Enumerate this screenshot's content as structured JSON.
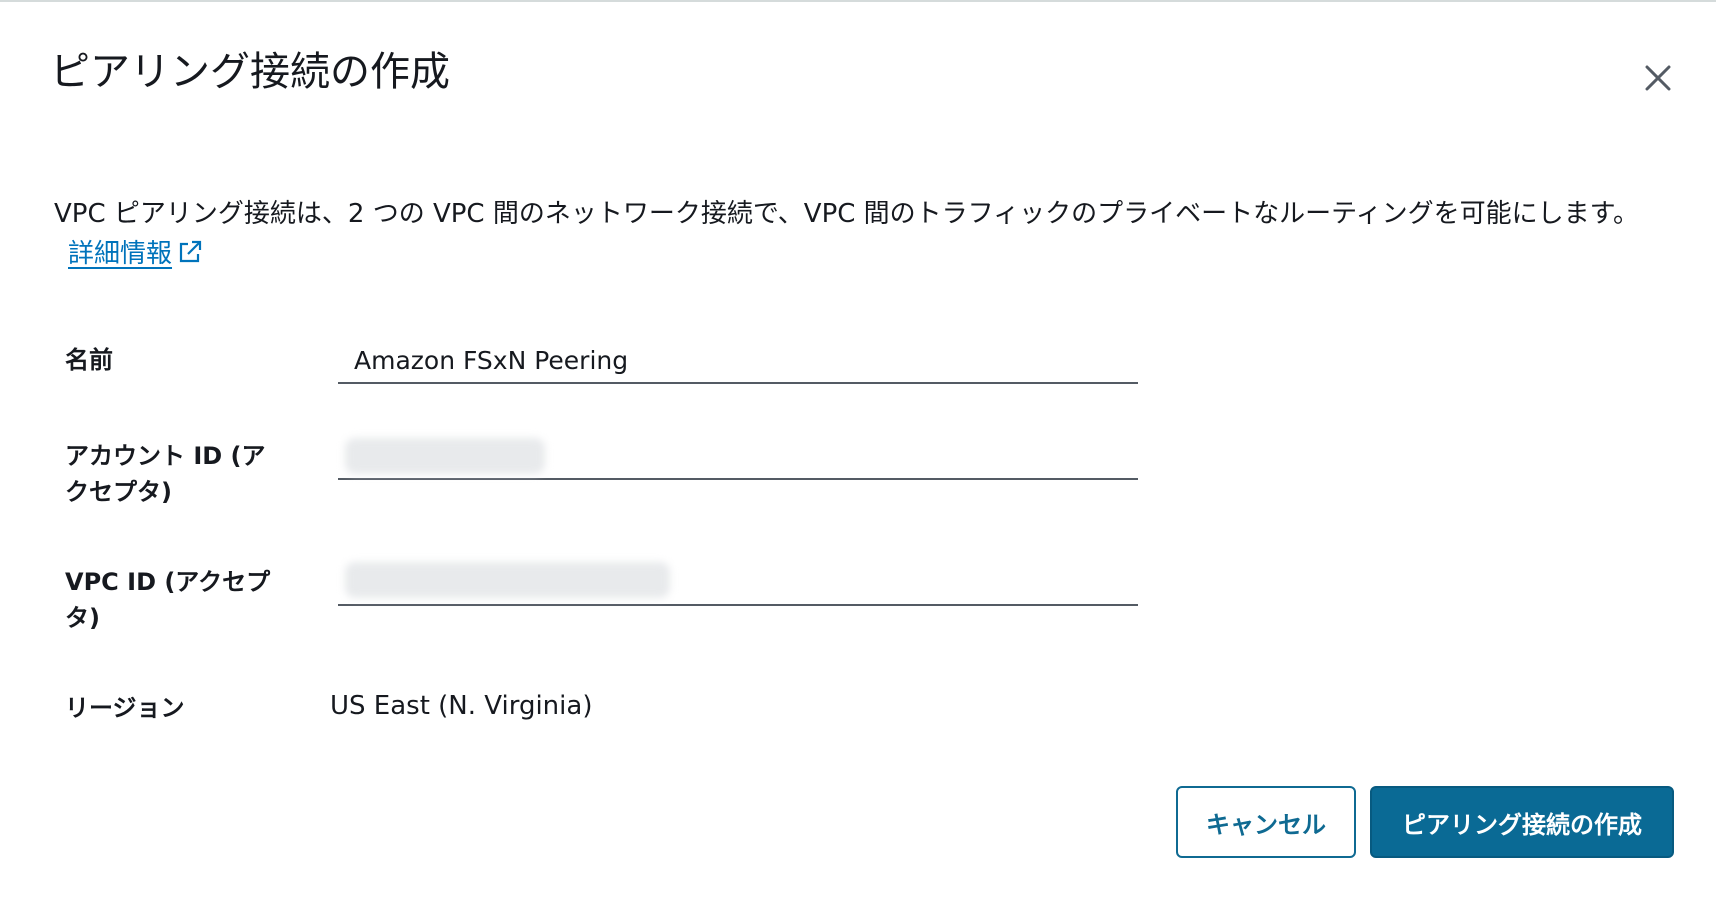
{
  "dialog": {
    "title": "ピアリング接続の作成",
    "description": "VPC ピアリング接続は、2 つの VPC 間のネットワーク接続で、VPC 間のトラフィックのプライベートなルーティングを可能にします。",
    "learn_more": "詳細情報",
    "close_icon": "close-icon",
    "external_link_icon": "external-link-icon"
  },
  "form": {
    "name": {
      "label": "名前",
      "value": "Amazon FSxN Peering"
    },
    "account_id": {
      "label": "アカウント ID (アクセプタ)",
      "value": ""
    },
    "vpc_id": {
      "label": "VPC ID (アクセプタ)",
      "value": ""
    },
    "region": {
      "label": "リージョン",
      "value": "US East (N. Virginia)"
    }
  },
  "actions": {
    "cancel_label": "キャンセル",
    "create_label": "ピアリング接続の作成"
  },
  "colors": {
    "primary": "#0a6a95",
    "link": "#0073bb",
    "text": "#16191f"
  }
}
